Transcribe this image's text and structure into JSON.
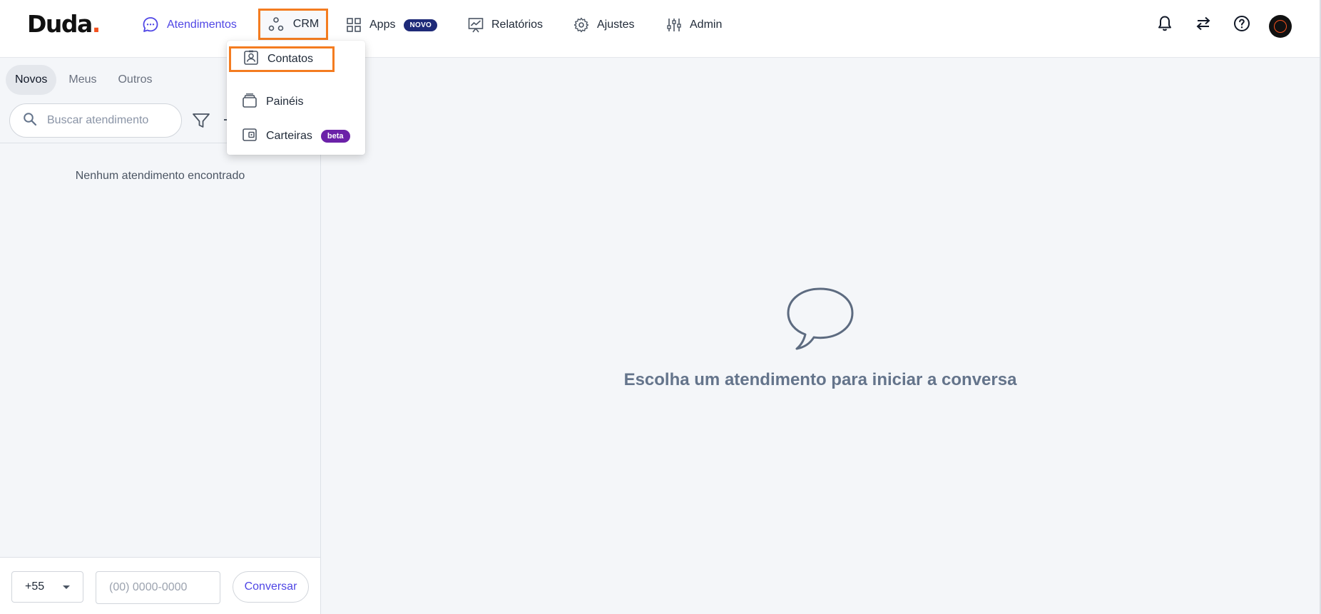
{
  "brand": {
    "name": "Duda",
    "dot": ".",
    "accent_color": "#f4511e"
  },
  "nav": {
    "atendimentos": {
      "label": "Atendimentos",
      "icon": "chat-bubble-icon",
      "active": true
    },
    "crm": {
      "label": "CRM",
      "icon": "crm-nodes-icon",
      "highlighted": true
    },
    "apps": {
      "label": "Apps",
      "icon": "grid-icon",
      "badge": "NOVO"
    },
    "relatorios": {
      "label": "Relatórios",
      "icon": "chart-board-icon"
    },
    "ajustes": {
      "label": "Ajustes",
      "icon": "gear-icon"
    },
    "admin": {
      "label": "Admin",
      "icon": "sliders-icon"
    }
  },
  "header_actions": [
    "bell-icon",
    "swap-arrows-icon",
    "help-icon",
    "avatar"
  ],
  "crm_menu": {
    "items": [
      {
        "label": "Contatos",
        "icon": "contact-card-icon",
        "highlighted": true
      },
      {
        "label": "Painéis",
        "icon": "stack-icon"
      },
      {
        "label": "Carteiras",
        "icon": "wallet-icon",
        "badge": "beta"
      }
    ]
  },
  "sidebar": {
    "tabs": [
      {
        "label": "Novos",
        "active": true
      },
      {
        "label": "Meus",
        "active": false
      },
      {
        "label": "Outros",
        "active": false
      }
    ],
    "search_placeholder": "Buscar atendimento",
    "empty_message": "Nenhum atendimento encontrado"
  },
  "quick_chat": {
    "country_code": "+55",
    "phone_placeholder": "(00) 0000-0000",
    "button_label": "Conversar"
  },
  "main": {
    "empty_message": "Escolha um atendimento para iniciar a conversa"
  },
  "colors": {
    "primary": "#4f46e5",
    "highlight_border": "#f47c20",
    "badge_novo": "#1e2a78",
    "badge_beta": "#6b21a8",
    "panel_bg": "#f4f6f9"
  }
}
